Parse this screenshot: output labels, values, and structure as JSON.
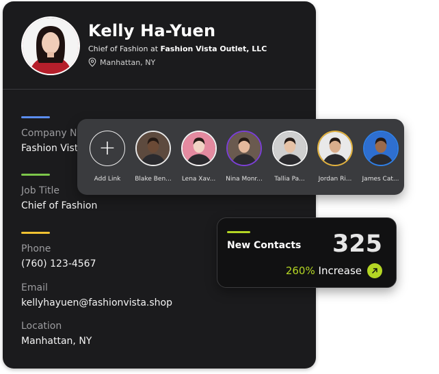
{
  "profile": {
    "name": "Kelly Ha-Yuen",
    "role_prefix": "Chief of Fashion at",
    "company": "Fashion Vista Outlet, LLC",
    "location": "Manhattan, NY",
    "fields": [
      {
        "label": "Company N",
        "value": "Fashion Vist",
        "accent": "#5b8def"
      },
      {
        "label": "Job Title",
        "value": "Chief of Fashion",
        "accent": "#7dc74a"
      },
      {
        "label": "Phone",
        "value": "(760) 123-4567",
        "accent": "#f1c232"
      },
      {
        "label": "Email",
        "value": "kellyhayuen@fashionvista.shop",
        "accent": ""
      },
      {
        "label": "Location",
        "value": "Manhattan, NY",
        "accent": ""
      }
    ]
  },
  "contacts": {
    "add_label": "Add Link",
    "items": [
      {
        "name": "Blake Ben...",
        "ring": "#e8e8e8",
        "bg": "#5d4a3e",
        "skin": "#6b4a36"
      },
      {
        "name": "Lena Xav...",
        "ring": "#f3f3f3",
        "bg": "#e48aa0",
        "skin": "#f1d3c4"
      },
      {
        "name": "Nina Monr...",
        "ring": "#7b3fd6",
        "bg": "#6a5a4f",
        "skin": "#e3b89c"
      },
      {
        "name": "Tallia Pa...",
        "ring": "#f3f3f3",
        "bg": "#cfcfcf",
        "skin": "#e6c2a6"
      },
      {
        "name": "Jordan Ri...",
        "ring": "#e3b23c",
        "bg": "#e9e9e9",
        "skin": "#d9ad8c"
      },
      {
        "name": "James Cat...",
        "ring": "#2f7fe6",
        "bg": "#2e6fd1",
        "skin": "#9a6a4c"
      }
    ]
  },
  "stats": {
    "title": "New Contacts",
    "value": "325",
    "percent": "260%",
    "increase_label": "Increase",
    "accent": "#b4d624"
  }
}
